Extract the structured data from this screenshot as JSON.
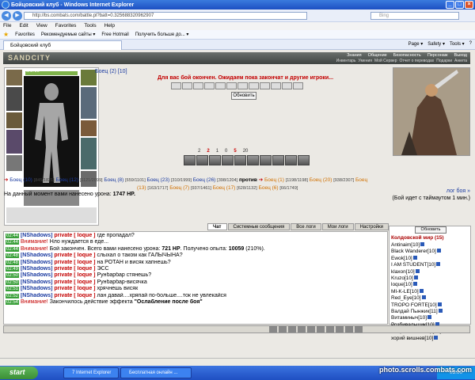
{
  "window": {
    "title": "Бойцовский клуб - Windows Internet Explorer",
    "url": "http://bs.combats.com/battle.pl?batt=0.325688320962907",
    "search_placeholder": "Bing"
  },
  "menu": [
    "File",
    "Edit",
    "View",
    "Favorites",
    "Tools",
    "Help"
  ],
  "favorites": [
    "Favorites",
    "Рекомендуемые сайты ▾",
    "Free Hotmail",
    "Получить больше до... ▾"
  ],
  "browser_tab": {
    "label": "Бойцовский клуб"
  },
  "tab_tools": [
    "Page ▾",
    "Safety ▾",
    "Tools ▾",
    "?"
  ],
  "game": {
    "logo": "SANDCITY",
    "nav": [
      "Знания",
      "Общение",
      "Безопасность",
      "Персонаж",
      "Выход"
    ],
    "nav2": [
      "Инвентарь",
      "Умения",
      "Мой Сервер",
      "Отчет о переводах",
      "Подарки",
      "Анкета"
    ],
    "char_name": "Боец (2) [10]",
    "char_hp": "0/1720",
    "message": "Для вас бой окончен. Ожидаем пока закончат и другие игроки...",
    "refresh": "Обновить",
    "stats": [
      "2",
      "2",
      "1",
      "0",
      "5",
      "20"
    ],
    "fighters_line1": {
      "left": [
        "Боец (10)",
        "[845/1821]",
        "Боец (12)",
        "[1121/2099]",
        "Боец (8)",
        "[659/1101]",
        "Боец (23)",
        "[310/1999]",
        "Боец (26)",
        "[398/1204]"
      ],
      "vs": "против",
      "right": [
        "Боец (1)",
        "[1198/1198]",
        "Боец (20)",
        "[938/2307]",
        "Боец"
      ]
    },
    "fighters_line2": [
      "(13)",
      "[163/1717]",
      "Боец (7)",
      "[937/1461]",
      "Боец (17)",
      "[628/1132]",
      "Боец (6)",
      "[66/1749]"
    ],
    "damage_label": "На данный момент вами нанесено урона:",
    "damage_value": "1747 HP.",
    "log_link": "лог боя »",
    "timeout": "(Бой идет с таймаутом 1 мин.)"
  },
  "chat_tabs": [
    "Чат",
    "Системные сообщения",
    "Все логи",
    "Мои логи",
    "Настройки"
  ],
  "chat": [
    {
      "t": "02:44",
      "who": "[NShadows]",
      "p": "private [ loque ]",
      "msg": "где пропадал?"
    },
    {
      "t": "02:44",
      "warn": "Внимание!",
      "msg": "Нло нуждается в еде..."
    },
    {
      "t": "02:44",
      "warn": "Внимание!",
      "msg": "Бой закончен. Всего вами нанесено урона:",
      "b1": "721 HP",
      "msg2": ". Получено опыта:",
      "b2": "10059",
      "msg3": "(210%)."
    },
    {
      "t": "02:48",
      "who": "[NShadows]",
      "p": "private [ loque ]",
      "msg": "слыхал о таком как ГАЛЫЧЫНА?"
    },
    {
      "t": "02:48",
      "who": "[NShadows]",
      "p": "private [ loque ]",
      "msg": "на РОТАН и висяк хапнешь?"
    },
    {
      "t": "02:49",
      "who": "[NShadows]",
      "p": "private [ loque ]",
      "msg": "ЭСС"
    },
    {
      "t": "02:50",
      "who": "[NShadows]",
      "p": "private [ loque ]",
      "msg": "Рунбарбар стянешь?"
    },
    {
      "t": "02:50",
      "who": "[NShadows]",
      "p": "private [ loque ]",
      "msg": "Рунбарбар-висячка"
    },
    {
      "t": "02:51",
      "who": "[NShadows]",
      "p": "private [ loque ]",
      "msg": "хрячнешь висяк"
    },
    {
      "t": "02:52",
      "who": "[NShadows]",
      "p": "private [ loque ]",
      "msg": "лан давай....хряпай по-больше....ток не увлекайся"
    },
    {
      "t": "02:54",
      "warn": "Внимание!",
      "msg": "Закончилось действие эффекта",
      "b1": "\"Ослабление после боя\""
    }
  ],
  "online": {
    "button": "Обновить",
    "group": "Колдовской мир (15)",
    "users": [
      "Antinaim[10]",
      "Black Wanderer[10]",
      "Ewok[10]",
      "I AM STUDENT[10]",
      "klaxon[10]",
      "Kruzo[10]",
      "loque[10]",
      "MI-K-LE[10]",
      "Red_Eye[10]",
      "TROPO FORTE[10]",
      "Валдай Пынжик[11]",
      "Витаминыч[10]",
      "Розбивальщик[10]",
      "Старина Мюллер[10]",
      "хорий вишнев[10]"
    ]
  },
  "taskbar": {
    "start": "start",
    "items": [
      "7 Internet Explorer",
      "Бесплатная онлайн ..."
    ],
    "clock": "03:00"
  },
  "watermark": "photo.scrolls.combats.com"
}
